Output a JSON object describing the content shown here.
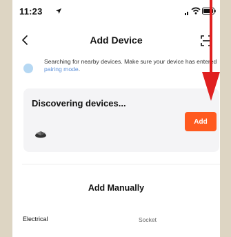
{
  "status_bar": {
    "time": "11:23",
    "icons": [
      "location-arrow-icon",
      "cellular-signal-icon",
      "wifi-icon",
      "battery-icon"
    ]
  },
  "nav": {
    "title": "Add Device",
    "back_icon": "chevron-left-icon",
    "scan_icon": "scan-icon"
  },
  "notice": {
    "text": "Searching for nearby devices. Make sure your device has entered ",
    "link": "pairing mode",
    "suffix": "."
  },
  "discover": {
    "title": "Discovering devices...",
    "add_label": "Add",
    "device_icon": "device-icon"
  },
  "manual": {
    "title": "Add Manually",
    "categories": [
      "Electrical",
      "Socket"
    ]
  },
  "colors": {
    "accent": "#ff5a1f",
    "link": "#5b8fd8",
    "card_bg": "#f4f4f6",
    "annotation_arrow": "#e02020"
  }
}
